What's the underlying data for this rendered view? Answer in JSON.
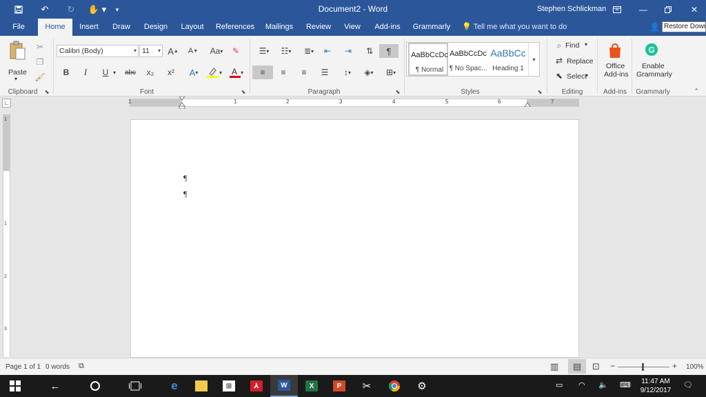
{
  "titlebar": {
    "document_title": "Document2  -  Word",
    "user_name": "Stephen Schlickman",
    "save_icon": "save-icon",
    "undo_icon": "undo-icon",
    "redo_icon": "redo-icon",
    "touch_icon": "touch-mode-icon",
    "restore_tooltip": "Restore Down"
  },
  "tabs": {
    "file": "File",
    "home": "Home",
    "insert": "Insert",
    "draw": "Draw",
    "design": "Design",
    "layout": "Layout",
    "references": "References",
    "mailings": "Mailings",
    "review": "Review",
    "view": "View",
    "addins": "Add-ins",
    "grammarly": "Grammarly",
    "tell_me": "Tell me what you want to do"
  },
  "ribbon": {
    "clipboard": {
      "paste": "Paste",
      "group": "Clipboard"
    },
    "font": {
      "name": "Calibri (Body)",
      "size": "11",
      "group": "Font",
      "bold": "B",
      "italic": "I",
      "underline": "U",
      "strike": "abc",
      "subscript": "x₂",
      "superscript": "x²",
      "grow": "A",
      "shrink": "A",
      "change_case": "Aa"
    },
    "paragraph": {
      "group": "Paragraph",
      "show_marks": "¶"
    },
    "styles": {
      "group": "Styles",
      "items": [
        {
          "sample": "AaBbCcDc",
          "name": "¶ Normal"
        },
        {
          "sample": "AaBbCcDc",
          "name": "¶ No Spac..."
        },
        {
          "sample": "AaBbCc",
          "name": "Heading 1"
        }
      ],
      "heading_color": "#2e74b5"
    },
    "editing": {
      "group": "Editing",
      "find": "Find",
      "replace": "Replace",
      "select": "Select"
    },
    "addins": {
      "group": "Add-ins",
      "office_addins_1": "Office",
      "office_addins_2": "Add-ins"
    },
    "grammarly": {
      "group": "Grammarly",
      "enable_1": "Enable",
      "enable_2": "Grammarly"
    }
  },
  "ruler": {
    "numbers": [
      "1",
      "1",
      "2",
      "3",
      "4",
      "5",
      "6",
      "7"
    ]
  },
  "vruler": {
    "numbers": [
      "1",
      "1",
      "2",
      "3"
    ]
  },
  "document": {
    "paragraph_marks": [
      "¶",
      "¶"
    ]
  },
  "status": {
    "page": "Page 1 of 1",
    "words": "0 words",
    "zoom": "100%",
    "minus": "−",
    "plus": "+"
  },
  "taskbar": {
    "time": "11:47 AM",
    "date": "9/12/2017",
    "apps": [
      "edge-icon",
      "file-explorer-icon",
      "store-icon",
      "acrobat-icon",
      "word-icon",
      "excel-icon",
      "powerpoint-icon",
      "snipping-icon",
      "chrome-icon",
      "settings-icon"
    ]
  },
  "colors": {
    "brand": "#2b579a",
    "ribbon_bg": "#f3f3f3",
    "workspace": "#e6e6e6"
  }
}
